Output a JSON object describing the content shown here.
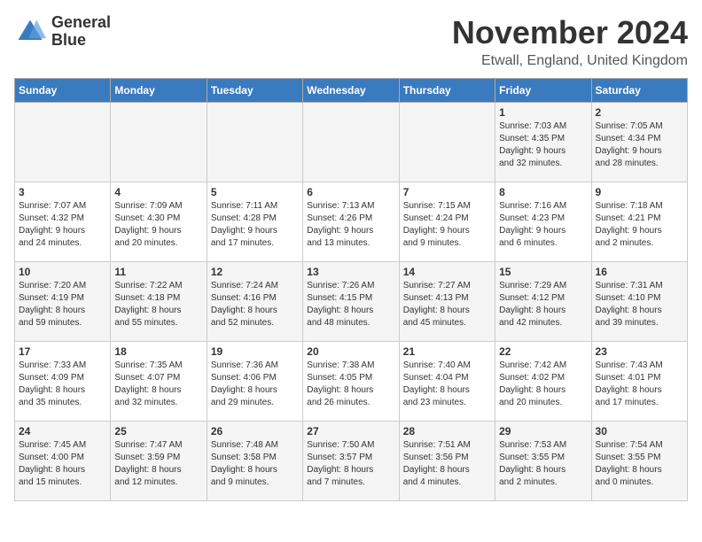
{
  "logo": {
    "line1": "General",
    "line2": "Blue"
  },
  "title": "November 2024",
  "location": "Etwall, England, United Kingdom",
  "headers": [
    "Sunday",
    "Monday",
    "Tuesday",
    "Wednesday",
    "Thursday",
    "Friday",
    "Saturday"
  ],
  "weeks": [
    [
      {
        "day": "",
        "info": ""
      },
      {
        "day": "",
        "info": ""
      },
      {
        "day": "",
        "info": ""
      },
      {
        "day": "",
        "info": ""
      },
      {
        "day": "",
        "info": ""
      },
      {
        "day": "1",
        "info": "Sunrise: 7:03 AM\nSunset: 4:35 PM\nDaylight: 9 hours\nand 32 minutes."
      },
      {
        "day": "2",
        "info": "Sunrise: 7:05 AM\nSunset: 4:34 PM\nDaylight: 9 hours\nand 28 minutes."
      }
    ],
    [
      {
        "day": "3",
        "info": "Sunrise: 7:07 AM\nSunset: 4:32 PM\nDaylight: 9 hours\nand 24 minutes."
      },
      {
        "day": "4",
        "info": "Sunrise: 7:09 AM\nSunset: 4:30 PM\nDaylight: 9 hours\nand 20 minutes."
      },
      {
        "day": "5",
        "info": "Sunrise: 7:11 AM\nSunset: 4:28 PM\nDaylight: 9 hours\nand 17 minutes."
      },
      {
        "day": "6",
        "info": "Sunrise: 7:13 AM\nSunset: 4:26 PM\nDaylight: 9 hours\nand 13 minutes."
      },
      {
        "day": "7",
        "info": "Sunrise: 7:15 AM\nSunset: 4:24 PM\nDaylight: 9 hours\nand 9 minutes."
      },
      {
        "day": "8",
        "info": "Sunrise: 7:16 AM\nSunset: 4:23 PM\nDaylight: 9 hours\nand 6 minutes."
      },
      {
        "day": "9",
        "info": "Sunrise: 7:18 AM\nSunset: 4:21 PM\nDaylight: 9 hours\nand 2 minutes."
      }
    ],
    [
      {
        "day": "10",
        "info": "Sunrise: 7:20 AM\nSunset: 4:19 PM\nDaylight: 8 hours\nand 59 minutes."
      },
      {
        "day": "11",
        "info": "Sunrise: 7:22 AM\nSunset: 4:18 PM\nDaylight: 8 hours\nand 55 minutes."
      },
      {
        "day": "12",
        "info": "Sunrise: 7:24 AM\nSunset: 4:16 PM\nDaylight: 8 hours\nand 52 minutes."
      },
      {
        "day": "13",
        "info": "Sunrise: 7:26 AM\nSunset: 4:15 PM\nDaylight: 8 hours\nand 48 minutes."
      },
      {
        "day": "14",
        "info": "Sunrise: 7:27 AM\nSunset: 4:13 PM\nDaylight: 8 hours\nand 45 minutes."
      },
      {
        "day": "15",
        "info": "Sunrise: 7:29 AM\nSunset: 4:12 PM\nDaylight: 8 hours\nand 42 minutes."
      },
      {
        "day": "16",
        "info": "Sunrise: 7:31 AM\nSunset: 4:10 PM\nDaylight: 8 hours\nand 39 minutes."
      }
    ],
    [
      {
        "day": "17",
        "info": "Sunrise: 7:33 AM\nSunset: 4:09 PM\nDaylight: 8 hours\nand 35 minutes."
      },
      {
        "day": "18",
        "info": "Sunrise: 7:35 AM\nSunset: 4:07 PM\nDaylight: 8 hours\nand 32 minutes."
      },
      {
        "day": "19",
        "info": "Sunrise: 7:36 AM\nSunset: 4:06 PM\nDaylight: 8 hours\nand 29 minutes."
      },
      {
        "day": "20",
        "info": "Sunrise: 7:38 AM\nSunset: 4:05 PM\nDaylight: 8 hours\nand 26 minutes."
      },
      {
        "day": "21",
        "info": "Sunrise: 7:40 AM\nSunset: 4:04 PM\nDaylight: 8 hours\nand 23 minutes."
      },
      {
        "day": "22",
        "info": "Sunrise: 7:42 AM\nSunset: 4:02 PM\nDaylight: 8 hours\nand 20 minutes."
      },
      {
        "day": "23",
        "info": "Sunrise: 7:43 AM\nSunset: 4:01 PM\nDaylight: 8 hours\nand 17 minutes."
      }
    ],
    [
      {
        "day": "24",
        "info": "Sunrise: 7:45 AM\nSunset: 4:00 PM\nDaylight: 8 hours\nand 15 minutes."
      },
      {
        "day": "25",
        "info": "Sunrise: 7:47 AM\nSunset: 3:59 PM\nDaylight: 8 hours\nand 12 minutes."
      },
      {
        "day": "26",
        "info": "Sunrise: 7:48 AM\nSunset: 3:58 PM\nDaylight: 8 hours\nand 9 minutes."
      },
      {
        "day": "27",
        "info": "Sunrise: 7:50 AM\nSunset: 3:57 PM\nDaylight: 8 hours\nand 7 minutes."
      },
      {
        "day": "28",
        "info": "Sunrise: 7:51 AM\nSunset: 3:56 PM\nDaylight: 8 hours\nand 4 minutes."
      },
      {
        "day": "29",
        "info": "Sunrise: 7:53 AM\nSunset: 3:55 PM\nDaylight: 8 hours\nand 2 minutes."
      },
      {
        "day": "30",
        "info": "Sunrise: 7:54 AM\nSunset: 3:55 PM\nDaylight: 8 hours\nand 0 minutes."
      }
    ]
  ]
}
